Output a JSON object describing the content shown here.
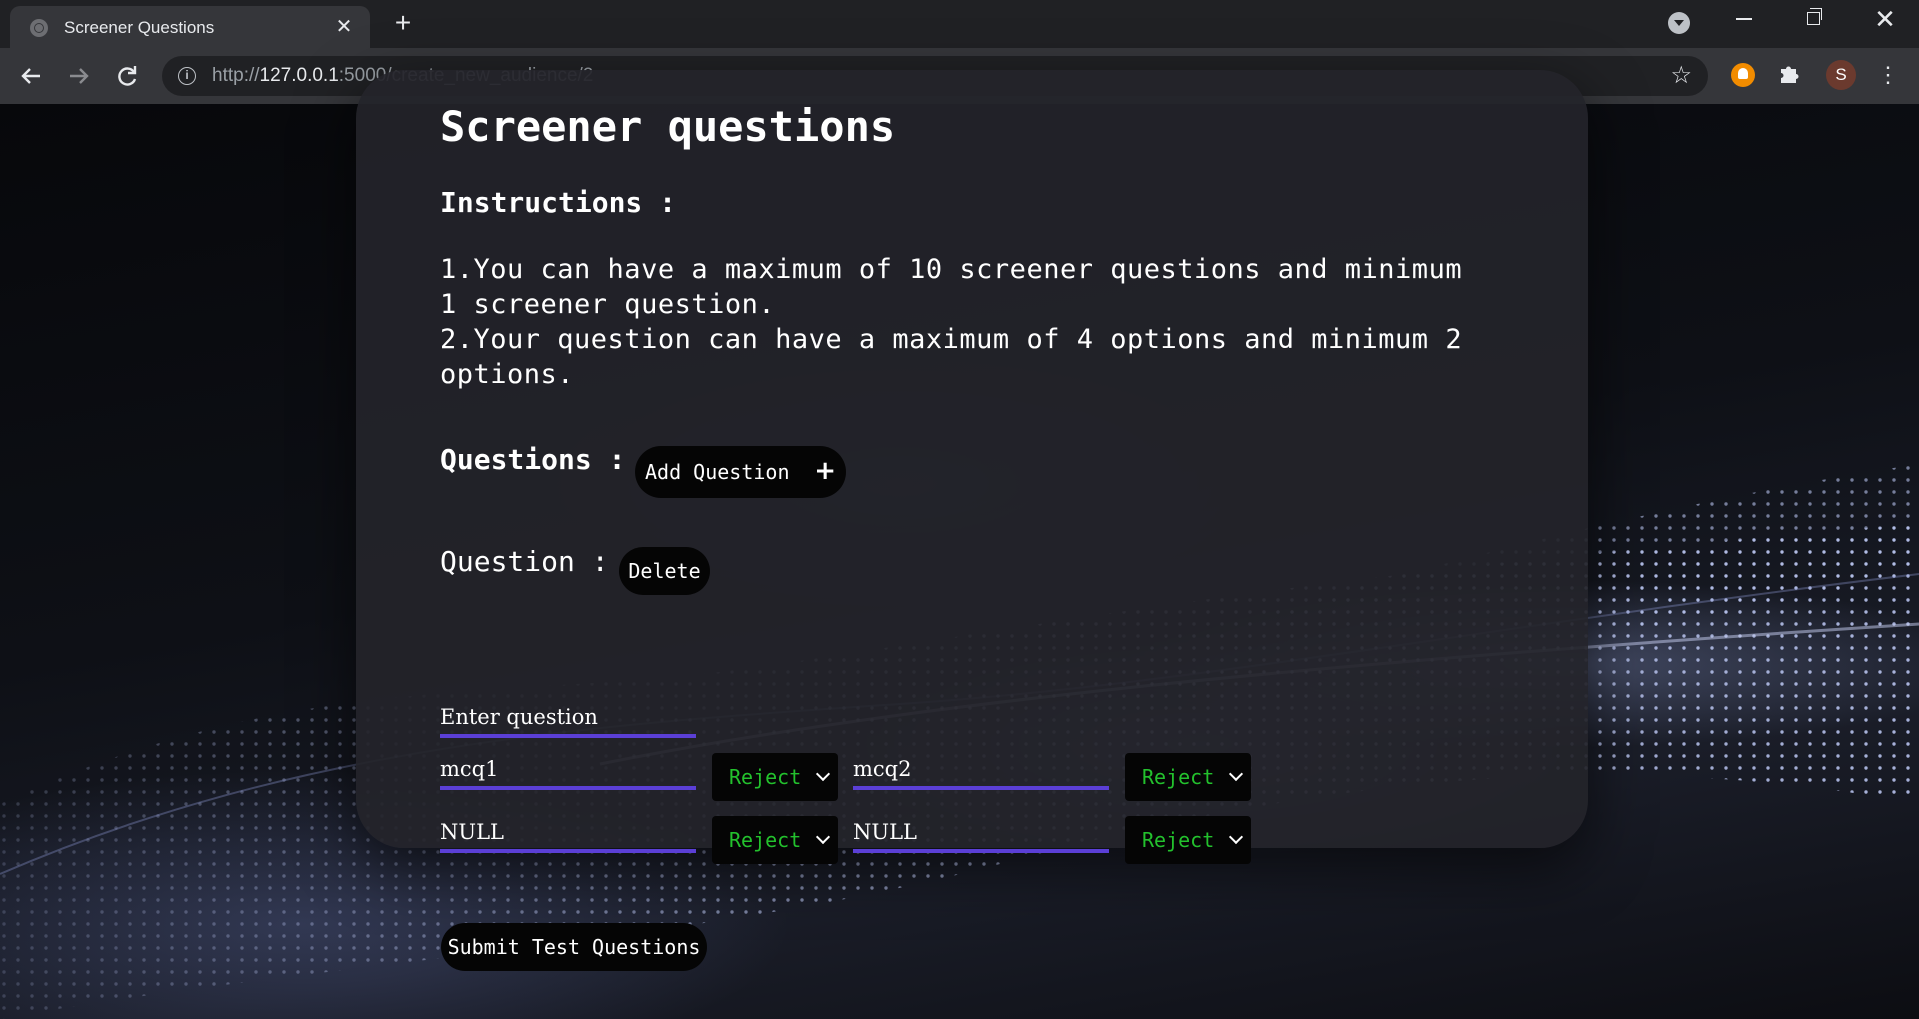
{
  "browser": {
    "tab_title": "Screener Questions",
    "tab_close": "✕",
    "new_tab": "+",
    "url_scheme": "http://",
    "url_host": "127.0.0.1",
    "url_rest": ":5000/create_new_audience/2",
    "avatar_letter": "S",
    "icons": [
      "globe-icon",
      "close-icon",
      "plus-icon",
      "tab-search-icon",
      "minimize-icon",
      "restore-icon",
      "window-close-icon",
      "back-arrow-icon",
      "forward-arrow-icon",
      "reload-icon",
      "info-icon",
      "star-icon",
      "bell-extension-icon",
      "puzzle-icon",
      "menu-icon"
    ]
  },
  "page": {
    "title": "Screener questions",
    "instructions_heading": "Instructions :",
    "instruction_1": "1.You can have a maximum of 10 screener questions and minimum 1 screener question.",
    "instruction_2": "2.Your question can have a maximum of 4 options and minimum 2 options.",
    "questions_heading": "Questions :",
    "add_question_label": "Add Question",
    "add_question_icon": "+",
    "question_label": "Question :",
    "delete_label": "Delete",
    "question_placeholder": "Enter question",
    "options": [
      {
        "value": "mcq1",
        "status": "Reject"
      },
      {
        "value": "mcq2",
        "status": "Reject"
      },
      {
        "value": "NULL",
        "status": "Reject"
      },
      {
        "value": "NULL",
        "status": "Reject"
      }
    ],
    "submit_label": "Submit Test Questions"
  },
  "colors": {
    "accent_underline": "#5b3fd6",
    "select_text": "#23c12d",
    "card_bg": "#24242a",
    "chrome_dark": "#202124",
    "chrome_toolbar": "#35363a"
  }
}
